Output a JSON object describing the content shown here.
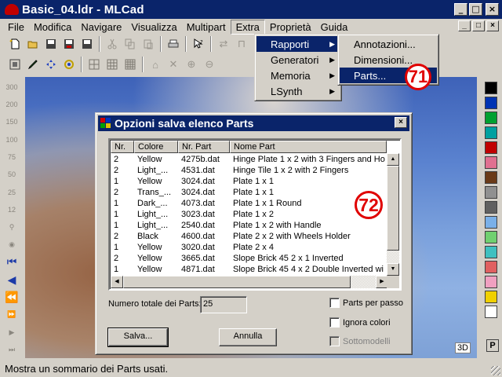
{
  "window": {
    "title": "Basic_04.ldr - MLCad",
    "controls": [
      "_",
      "□",
      "×"
    ]
  },
  "menubar": {
    "items": [
      "File",
      "Modifica",
      "Navigare",
      "Visualizza",
      "Multipart",
      "Extra",
      "Proprietà",
      "Guida"
    ],
    "mdi_controls": [
      "_",
      "□",
      "×"
    ]
  },
  "extra_menu": {
    "items": [
      {
        "label": "Rapporti",
        "has_submenu": true,
        "highlighted": true
      },
      {
        "label": "Generatori",
        "has_submenu": true,
        "highlighted": false
      },
      {
        "label": "Memoria",
        "has_submenu": true,
        "highlighted": false
      },
      {
        "label": "LSynth",
        "has_submenu": true,
        "highlighted": false
      }
    ]
  },
  "rapporti_menu": {
    "items": [
      {
        "label": "Annotazioni...",
        "highlighted": false
      },
      {
        "label": "Dimensioni...",
        "highlighted": false
      },
      {
        "label": "Parts...",
        "highlighted": true
      }
    ]
  },
  "callouts": {
    "first": "71",
    "second": "72"
  },
  "left_toolbar": {
    "zoom_labels": [
      "300",
      "200",
      "150",
      "100",
      "75",
      "50",
      "25",
      "12"
    ]
  },
  "palette": {
    "colors": [
      "#000000",
      "#0033b3",
      "#00a030",
      "#00a0a0",
      "#c00000",
      "#e07090",
      "#6a3a18",
      "#909090",
      "#606060",
      "#7ab0e8",
      "#70d070",
      "#40c0c0",
      "#e06060",
      "#f0a0c0",
      "#f0d000",
      "#ffffff"
    ]
  },
  "viewport": {
    "mode_label": "3D",
    "persp_label": "P"
  },
  "dialog": {
    "title": "Opzioni salva elenco Parts",
    "close_label": "×",
    "columns": [
      "Nr.",
      "Colore",
      "Nr. Part",
      "Nome Part"
    ],
    "rows": [
      [
        "2",
        "Yellow",
        "4275b.dat",
        "Hinge Plate  1 x  2 with 3 Fingers and Ho"
      ],
      [
        "2",
        "Light_...",
        "4531.dat",
        "Hinge Tile  1 x  2 with 2 Fingers"
      ],
      [
        "1",
        "Yellow",
        "3024.dat",
        "Plate  1 x  1"
      ],
      [
        "2",
        "Trans_...",
        "3024.dat",
        "Plate  1 x  1"
      ],
      [
        "1",
        "Dark_...",
        "4073.dat",
        "Plate  1 x  1 Round"
      ],
      [
        "1",
        "Light_...",
        "3023.dat",
        "Plate  1 x  2"
      ],
      [
        "1",
        "Light_...",
        "2540.dat",
        "Plate  1 x  2 with Handle"
      ],
      [
        "2",
        "Black",
        "4600.dat",
        "Plate  2 x  2 with Wheels Holder"
      ],
      [
        "1",
        "Yellow",
        "3020.dat",
        "Plate  2 x  4"
      ],
      [
        "2",
        "Yellow",
        "3665.dat",
        "Slope Brick 45  2 x  1 Inverted"
      ],
      [
        "1",
        "Yellow",
        "4871.dat",
        "Slope Brick 45  4 x  2 Double Inverted wi"
      ]
    ],
    "total_label": "Numero totale dei Parts:",
    "total_value": "25",
    "checkboxes": [
      {
        "label": "Parts per passo",
        "checked": false,
        "enabled": true
      },
      {
        "label": "Ignora colori",
        "checked": false,
        "enabled": true
      },
      {
        "label": "Sottomodelli",
        "checked": false,
        "enabled": false
      }
    ],
    "save_button": "Salva...",
    "cancel_button": "Annulla"
  },
  "statusbar": {
    "text": "Mostra un sommario dei Parts usati."
  }
}
